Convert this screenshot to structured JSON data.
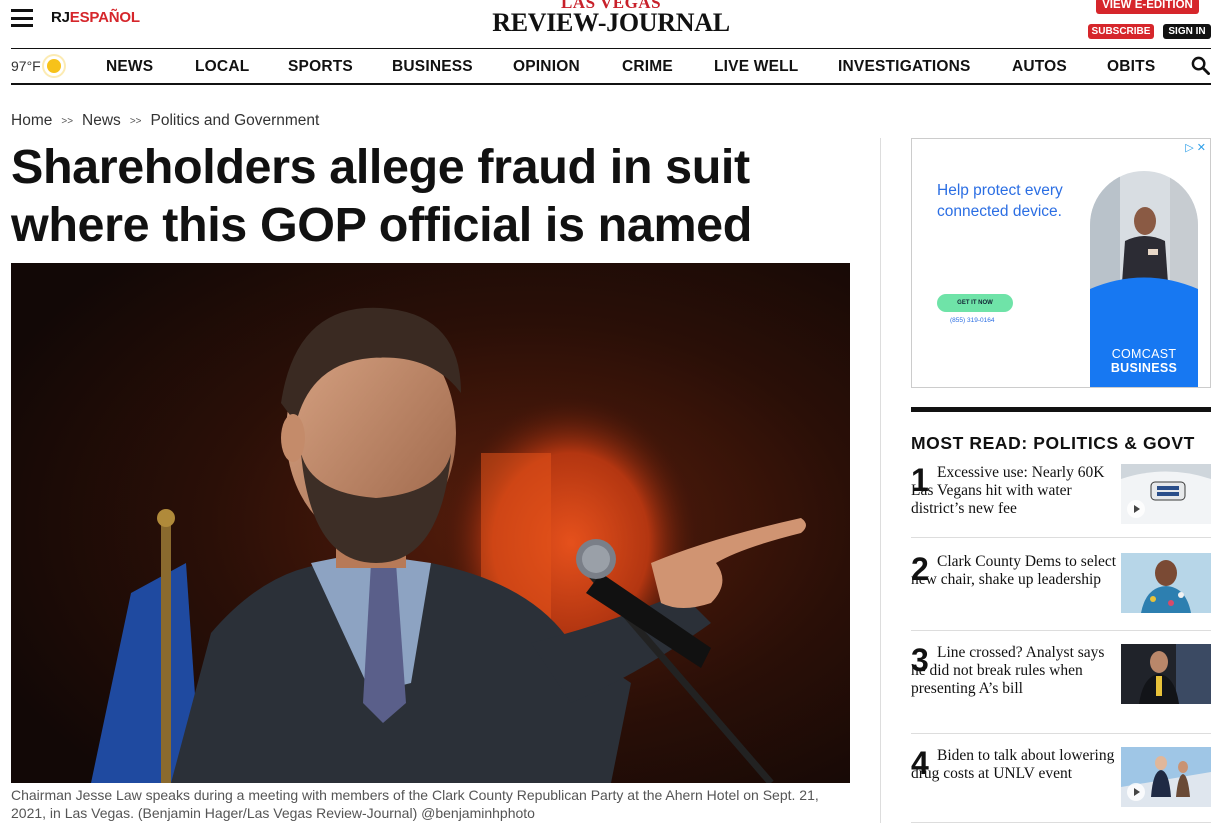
{
  "header": {
    "brand_rj": "RJ",
    "brand_espanol": "ESPAÑOL",
    "masthead_top": "LAS VEGAS",
    "masthead_bottom": "REVIEW-JOURNAL",
    "edition_button": "VIEW E-EDITION",
    "subscribe_button": "SUBSCRIBE",
    "signin_button": "SIGN IN"
  },
  "weather": {
    "temp": "97°F",
    "icon": "sun-icon"
  },
  "nav": {
    "items": [
      "NEWS",
      "LOCAL",
      "SPORTS",
      "BUSINESS",
      "OPINION",
      "CRIME",
      "LIVE WELL",
      "INVESTIGATIONS",
      "AUTOS",
      "OBITS"
    ]
  },
  "breadcrumb": [
    "Home",
    "News",
    "Politics and Government"
  ],
  "breadcrumb_sep": ">>",
  "article": {
    "headline": "Shareholders allege fraud in suit where this GOP official is named",
    "caption": "Chairman Jesse Law speaks during a meeting with members of the Clark County Republican Party at the Ahern Hotel on Sept. 21, 2021, in Las Vegas. (Benjamin Hager/Las Vegas Review-Journal) @benjaminhphoto"
  },
  "ad": {
    "headline": "Help protect every connected device.",
    "cta": "GET IT NOW",
    "phone": "(855) 319-0164",
    "brand_line1": "COMCAST",
    "brand_line2": "BUSINESS"
  },
  "most_read": {
    "title": "MOST READ: POLITICS & GOVT",
    "items": [
      {
        "num": "1",
        "text": "Excessive use: Nearly 60K Las Vegans hit with water district’s new fee"
      },
      {
        "num": "2",
        "text": "Clark County Dems to select new chair, shake up leadership"
      },
      {
        "num": "3",
        "text": "Line crossed? Analyst says he did not break rules when presenting A’s bill"
      },
      {
        "num": "4",
        "text": "Biden to talk about lowering drug costs at UNLV event"
      }
    ]
  },
  "colors": {
    "accent_red": "#d6262b",
    "ad_blue": "#2b6ee3",
    "ad_green": "#6fe3a8"
  }
}
